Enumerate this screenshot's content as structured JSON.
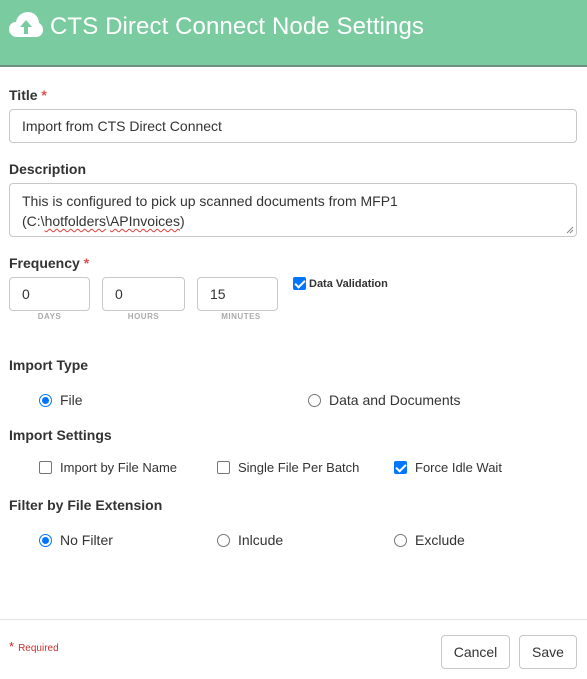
{
  "header": {
    "title": "CTS Direct Connect Node Settings"
  },
  "title_field": {
    "label": "Title",
    "required_mark": "*",
    "value": "Import from CTS Direct Connect"
  },
  "description_field": {
    "label": "Description",
    "line1": "This is configured to pick up scanned documents from MFP1",
    "line2_prefix": "(C:\\",
    "line2_word1": "hotfolders",
    "line2_sep": "\\",
    "line2_word2": "APInvoices",
    "line2_suffix": ")"
  },
  "frequency": {
    "label": "Frequency",
    "required_mark": "*",
    "days": {
      "value": "0",
      "label": "DAYS"
    },
    "hours": {
      "value": "0",
      "label": "HOURS"
    },
    "minutes": {
      "value": "15",
      "label": "MINUTES"
    },
    "data_validation": {
      "label": "Data Validation",
      "checked": true
    }
  },
  "import_type": {
    "label": "Import Type",
    "options": [
      {
        "label": "File",
        "selected": true
      },
      {
        "label": "Data and Documents",
        "selected": false
      }
    ]
  },
  "import_settings": {
    "label": "Import Settings",
    "options": [
      {
        "label": "Import by File Name",
        "checked": false
      },
      {
        "label": "Single File Per Batch",
        "checked": false
      },
      {
        "label": "Force Idle Wait",
        "checked": true
      }
    ]
  },
  "filter": {
    "label": "Filter by File Extension",
    "options": [
      {
        "label": "No Filter",
        "selected": true
      },
      {
        "label": "Inlcude",
        "selected": false
      },
      {
        "label": "Exclude",
        "selected": false
      }
    ]
  },
  "footer": {
    "required_star": "*",
    "required_text": "Required",
    "cancel_label": "Cancel",
    "save_label": "Save"
  },
  "colors": {
    "header_bg": "#7bcba0",
    "accent": "#0075ff",
    "required": "#d9534f"
  }
}
